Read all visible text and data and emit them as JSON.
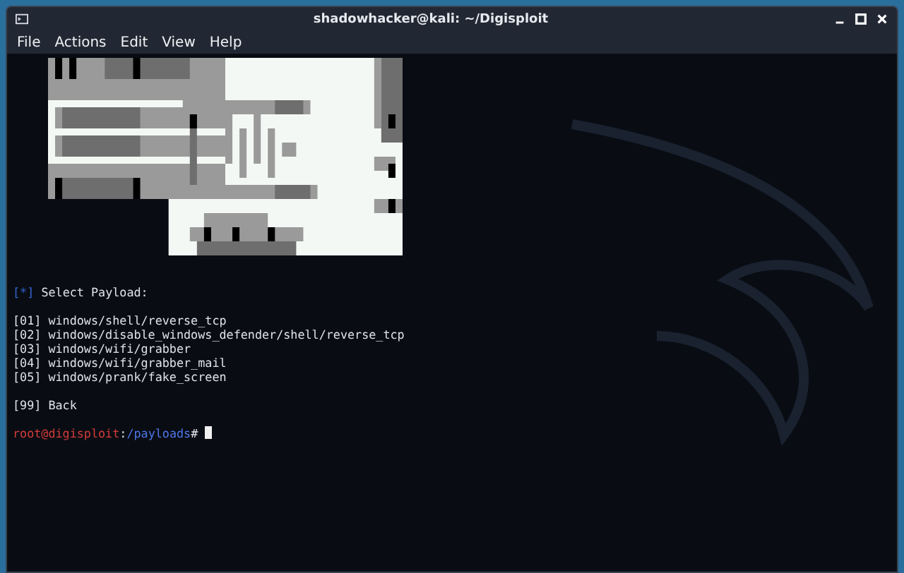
{
  "window": {
    "title": "shadowhacker@kali: ~/Digisploit"
  },
  "menu": [
    "File",
    "Actions",
    "Edit",
    "View",
    "Help"
  ],
  "terminal": {
    "header": {
      "marker": "[*]",
      "text": "Select Payload:"
    },
    "options": [
      {
        "number": "[01]",
        "label": "windows/shell/reverse_tcp"
      },
      {
        "number": "[02]",
        "label": "windows/disable_windows_defender/shell/reverse_tcp"
      },
      {
        "number": "[03]",
        "label": "windows/wifi/grabber"
      },
      {
        "number": "[04]",
        "label": "windows/wifi/grabber_mail"
      },
      {
        "number": "[05]",
        "label": "windows/prank/fake_screen"
      }
    ],
    "back": {
      "number": "[99]",
      "label": "Back"
    },
    "prompt": {
      "user": "root@digisploit",
      "separator": ":",
      "path": "/payloads",
      "symbol": "#"
    }
  }
}
